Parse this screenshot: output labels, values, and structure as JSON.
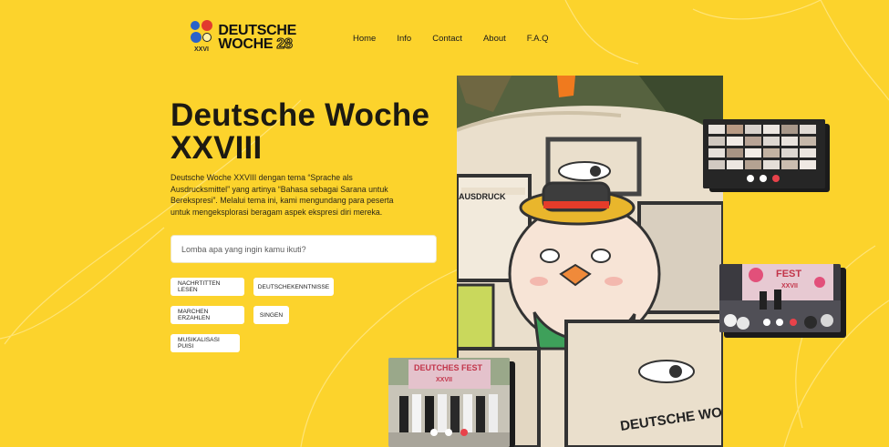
{
  "header": {
    "logo_line1": "DEUTSCHE",
    "logo_line2": "WOCHE",
    "logo_num": "28",
    "logo_mark_text": "XXVI",
    "nav": [
      "Home",
      "Info",
      "Contact",
      "About",
      "F.A.Q"
    ]
  },
  "hero": {
    "title_line1": "Deutsche Woche",
    "title_line2": "XXVIII",
    "description": "Deutsche Woche XXVIII dengan tema “Sprache als Ausdrucksmittel” yang artinya “Bahasa sebagai Sarana untuk Berekspresi”. Melalui tema ini, kami mengundang para peserta untuk mengeksplorasi beragam aspek ekspresi diri mereka."
  },
  "search": {
    "placeholder": "Lomba apa yang ingin kamu ikuti?"
  },
  "competitions": [
    "NACHRTITTEN LESEN",
    "DEUTSCHEKENNTNISSE",
    "MARCHEN ERZAHLEN",
    "SINGEN",
    "MUSIKALISASI PUISI"
  ],
  "images": {
    "tote_print_top": "AUSDRUCK",
    "tote_print_bottom": "DEUTSCHE WO",
    "festival_banner": "FEST",
    "festival_banner_sub": "XXVII",
    "group_banner": "DEUTCHES FEST",
    "group_banner_sub": "XXVII"
  },
  "colors": {
    "background": "#FCD32C",
    "text": "#1d1a14",
    "chip": "#FFFFFF"
  }
}
